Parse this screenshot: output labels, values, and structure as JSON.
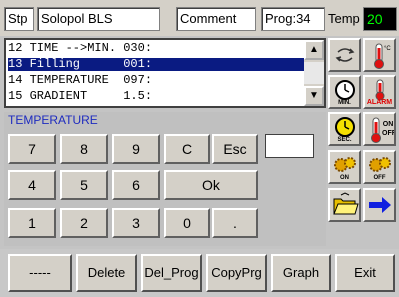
{
  "header": {
    "stp_label": "Stp",
    "program_name": "Solopol BLS",
    "comment_label": "Comment",
    "prog_label": "Prog:34",
    "temp_label": "Temp",
    "temp_value": "20"
  },
  "list": {
    "rows": [
      "12 TIME -->MIN. 030:",
      "13 Filling      001:",
      "14 TEMPERATURE  097:",
      "15 GRADIENT     1.5:"
    ],
    "scroll_up": "▲",
    "scroll_down": "▼"
  },
  "keypad": {
    "title": "TEMPERATURE",
    "k7": "7",
    "k8": "8",
    "k9": "9",
    "kc": "C",
    "kesc": "Esc",
    "k4": "4",
    "k5": "5",
    "k6": "6",
    "kok": "Ok",
    "k1": "1",
    "k2": "2",
    "k3": "3",
    "k0": "0",
    "kdot": "."
  },
  "sidebar": {
    "min_label": "MIN.",
    "alarm_label": "ALARM",
    "sec_label": "SEC.",
    "on_off_label": "ON OFF",
    "on_label": "ON",
    "off_label": "OFF"
  },
  "footer": {
    "b1": "-----",
    "b2": "Delete",
    "b3": "Del_Prog",
    "b4": "CopyPrg",
    "b5": "Graph",
    "b6": "Exit"
  }
}
